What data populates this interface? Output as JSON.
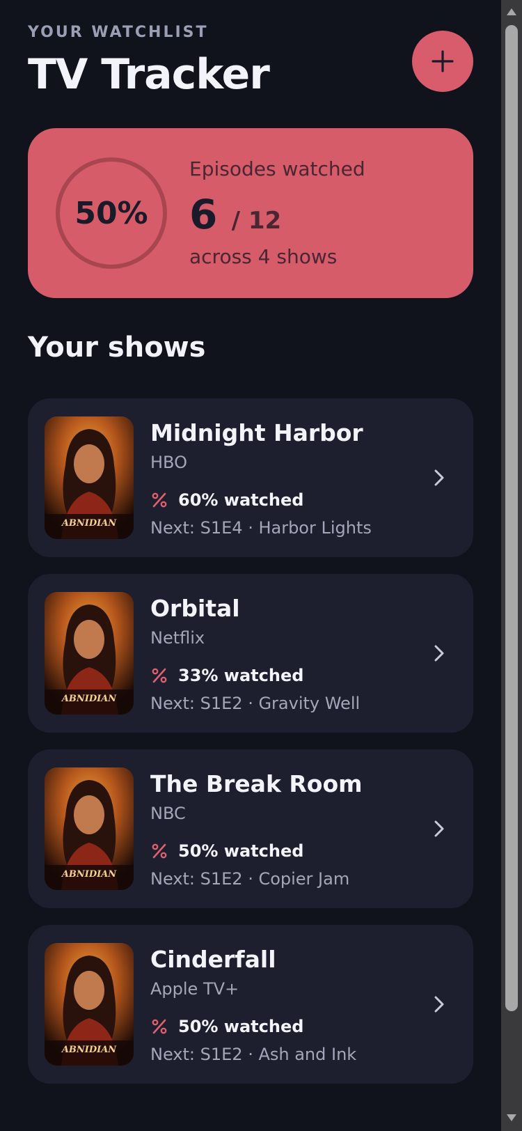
{
  "header": {
    "eyebrow": "YOUR WATCHLIST",
    "title": "TV Tracker",
    "add_icon": "plus-icon"
  },
  "summary": {
    "percent_label": "50%",
    "percent_value": 0.5,
    "label": "Episodes watched",
    "watched": "6",
    "total": "/ 12",
    "subtitle": "across 4 shows",
    "accent_color": "#d65c6a"
  },
  "section_title": "Your shows",
  "shows": [
    {
      "name": "Midnight Harbor",
      "network": "HBO",
      "progress": "60% watched",
      "next": "Next: S1E4 · Harbor Lights",
      "poster_text": "ABNIDIAN"
    },
    {
      "name": "Orbital",
      "network": "Netflix",
      "progress": "33% watched",
      "next": "Next: S1E2 · Gravity Well",
      "poster_text": "ABNIDIAN"
    },
    {
      "name": "The Break Room",
      "network": "NBC",
      "progress": "50% watched",
      "next": "Next: S1E2 · Copier Jam",
      "poster_text": "ABNIDIAN"
    },
    {
      "name": "Cinderfall",
      "network": "Apple TV+",
      "progress": "50% watched",
      "next": "Next: S1E2 · Ash and Ink",
      "poster_text": "ABNIDIAN"
    }
  ]
}
